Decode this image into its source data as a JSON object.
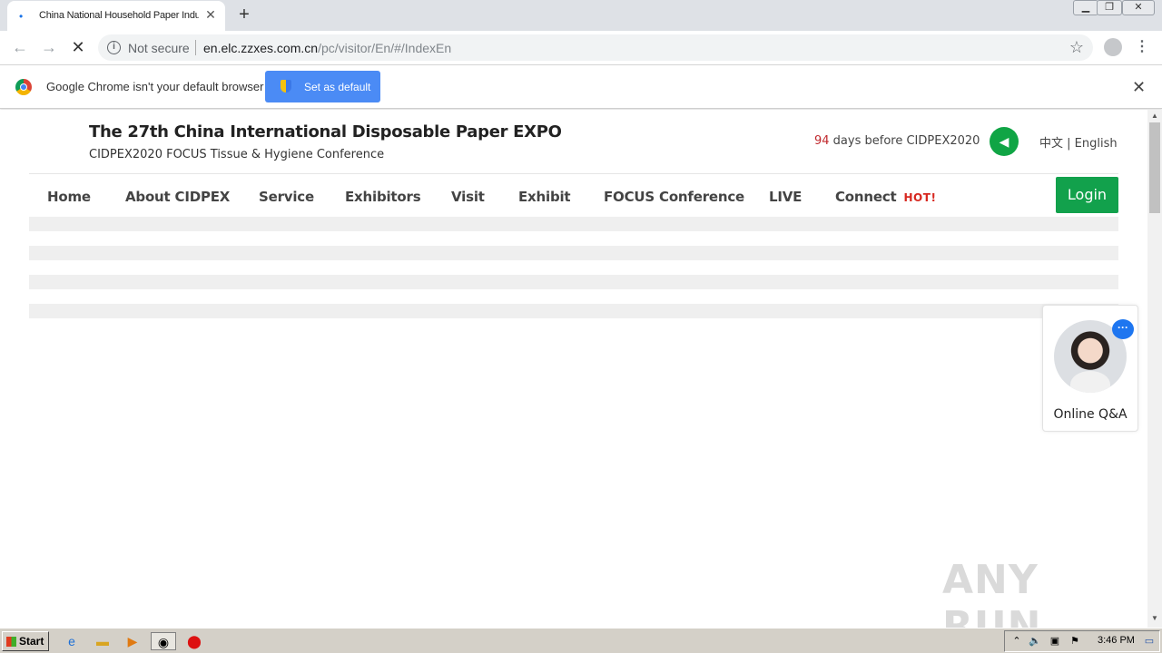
{
  "browser": {
    "tab_title": "China National Household Paper Industry Association",
    "new_tab": "+",
    "omnibox": {
      "security_label": "Not secure",
      "url_host": "en.elc.zzxes.com.cn",
      "url_path": "/pc/visitor/En/#/IndexEn"
    },
    "infobar": {
      "message": "Google Chrome isn't your default browser",
      "button_label": "Set as default"
    }
  },
  "site": {
    "title": "The 27th China International Disposable Paper EXPO",
    "subtitle": "CIDPEX2020 FOCUS Tissue & Hygiene Conference",
    "countdown_number": "94",
    "countdown_text": " days before CIDPEX2020",
    "language": "中文 | English",
    "nav": [
      "Home",
      "About CIDPEX",
      "Service",
      "Exhibitors",
      "Visit",
      "Exhibit",
      "FOCUS Conference",
      "LIVE",
      "Connect"
    ],
    "hot_badge": "HOT!",
    "login_label": "Login",
    "online_qa_label": "Online Q&A"
  },
  "watermark": "ANY RUN",
  "taskbar": {
    "start_label": "Start",
    "clock": "3:46 PM"
  },
  "colors": {
    "accent_green": "#12a14c",
    "countdown_red": "#c0282d",
    "hot_red": "#d7271f",
    "chrome_blue": "#4b8bf5"
  }
}
